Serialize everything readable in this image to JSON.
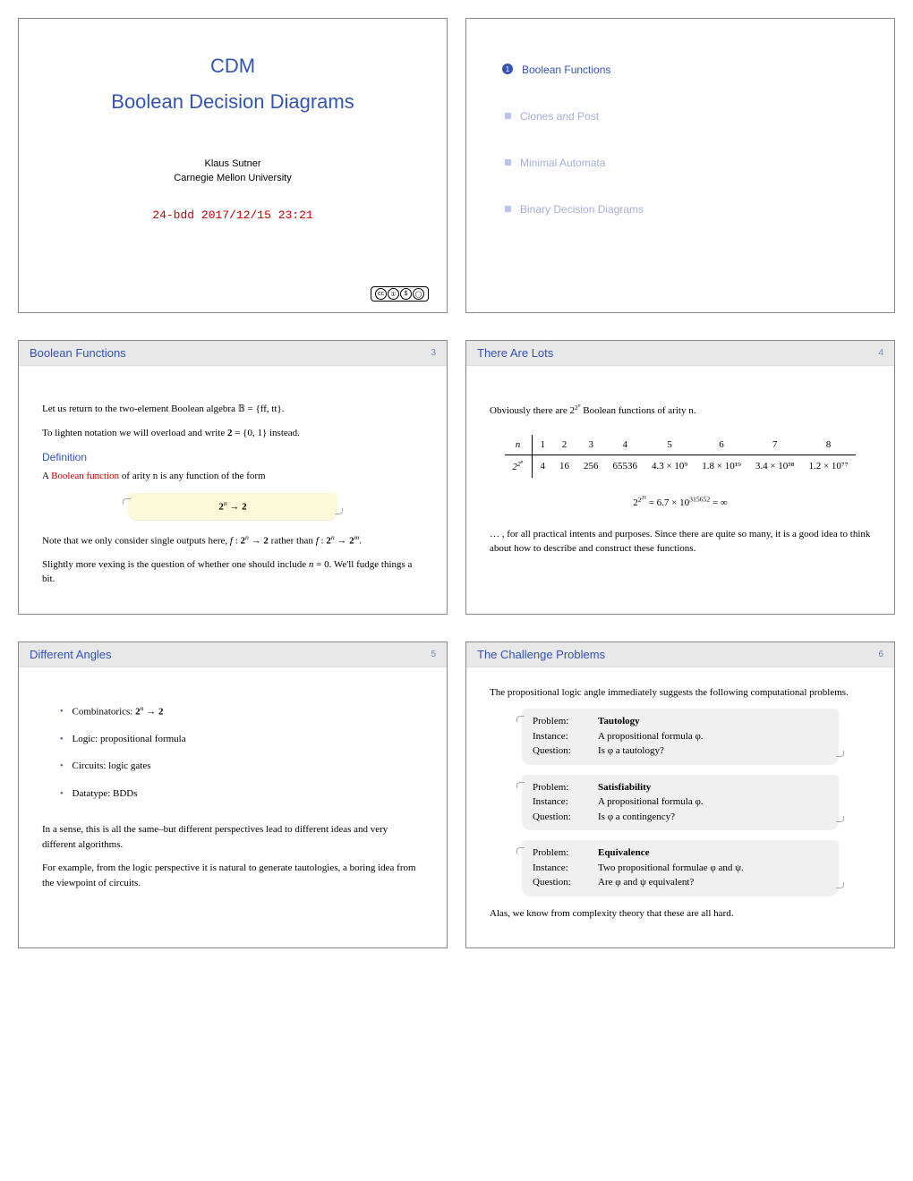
{
  "title": {
    "line1": "CDM",
    "line2": "Boolean Decision Diagrams",
    "author": "Klaus Sutner",
    "affil": "Carnegie Mellon University",
    "date": "24-bdd    2017/12/15 23:21"
  },
  "toc": [
    {
      "label": "Boolean Functions",
      "style": "active"
    },
    {
      "label": "Clones and Post",
      "style": "dim"
    },
    {
      "label": "Minimal Automata",
      "style": "dim"
    },
    {
      "label": "Binary Decision Diagrams",
      "style": "dim"
    }
  ],
  "s3": {
    "title": "Boolean Functions",
    "num": "3",
    "p1a": "Let us return to the two-element Boolean algebra ",
    "p1b": " = {ff, tt}.",
    "p2a": "To lighten notation we will overload and write ",
    "p2b": "2",
    "p2c": " = {0, 1} instead.",
    "def_label": "Definition",
    "def_a": "A ",
    "def_term": "Boolean function",
    "def_b": " of arity n is any function of the form",
    "hl": "2ⁿ → 2",
    "p3": "Note that we only consider single outputs here, f : 2ⁿ → 2 rather than f : 2ⁿ → 2ᵐ.",
    "p4": "Slightly more vexing is the question of whether one should include n = 0. We'll fudge things a bit."
  },
  "s4": {
    "title": "There Are Lots",
    "num": "4",
    "p1a": "Obviously there are ",
    "p1b": " Boolean functions of arity n.",
    "table": {
      "row_n_label": "n",
      "ns": [
        "1",
        "2",
        "3",
        "4",
        "5",
        "6",
        "7",
        "8"
      ],
      "row_f_label": "2^{2ⁿ}",
      "fs": [
        "4",
        "16",
        "256",
        "65536",
        "4.3 × 10⁹",
        "1.8 × 10¹⁹",
        "3.4 × 10³⁸",
        "1.2 × 10⁷⁷"
      ]
    },
    "big": "2^{2²⁰} = 6.7 × 10³¹⁵⁶⁵² = ∞",
    "p2": "… , for all practical intents and purposes. Since there are quite so many, it is a good idea to think about how to describe and construct these functions."
  },
  "s5": {
    "title": "Different Angles",
    "num": "5",
    "items": [
      "Combinatorics: 2ⁿ → 2",
      "Logic: propositional formula",
      "Circuits: logic gates",
      "Datatype: BDDs"
    ],
    "p1": "In a sense, this is all the same–but different perspectives lead to different ideas and very different algorithms.",
    "p2": "For example, from the logic perspective it is natural to generate tautologies, a boring idea from the viewpoint of circuits."
  },
  "s6": {
    "title": "The Challenge Problems",
    "num": "6",
    "intro": "The propositional logic angle immediately suggests the following computational problems.",
    "labels": {
      "problem": "Problem:",
      "instance": "Instance:",
      "question": "Question:"
    },
    "probs": [
      {
        "name": "Tautology",
        "inst": "A propositional formula φ.",
        "q": "Is φ a tautology?"
      },
      {
        "name": "Satisfiability",
        "inst": "A propositional formula φ.",
        "q": "Is φ a contingency?"
      },
      {
        "name": "Equivalence",
        "inst": "Two propositional formulae φ and ψ.",
        "q": "Are φ and ψ equivalent?"
      }
    ],
    "outro": "Alas, we know from complexity theory that these are all hard."
  }
}
